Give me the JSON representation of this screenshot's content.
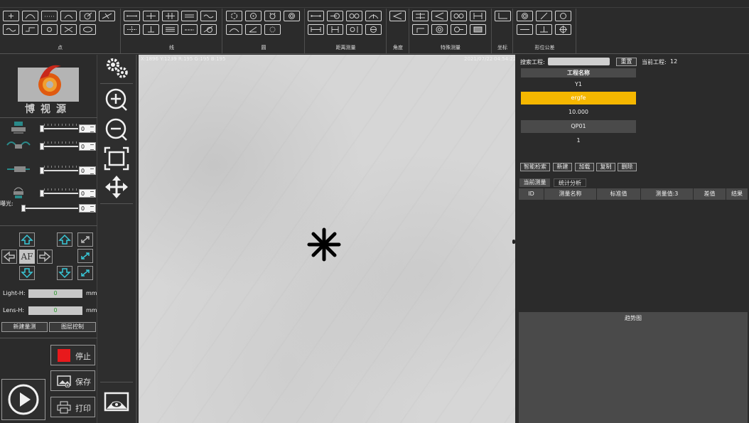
{
  "toolbar": {
    "groups": [
      {
        "label": "点"
      },
      {
        "label": "线"
      },
      {
        "label": "圆"
      },
      {
        "label": "距离测量"
      },
      {
        "label": "角度"
      },
      {
        "label": "特殊测量"
      },
      {
        "label": "坐标"
      },
      {
        "label": "形位公差"
      }
    ]
  },
  "logo": {
    "text": "博视源"
  },
  "lights": {
    "values": [
      "0",
      "0",
      "0",
      "0"
    ],
    "exposure_label": "曝光:",
    "exposure_value": "0"
  },
  "motion": {
    "af_label": "AF"
  },
  "heights": {
    "light_label": "Light-H:",
    "light_value": "0",
    "lens_label": "Lens-H:",
    "lens_value": "0",
    "unit": "mm"
  },
  "left_buttons": {
    "new_measure": "新建量测",
    "layer_control": "图层控制",
    "stop": "停止",
    "save": "保存",
    "print": "打印"
  },
  "image_view": {
    "coords": "X:1896  Y:1239  R:195  G:195  B:195",
    "date": "2021/07/22",
    "time": "04:54:22"
  },
  "right_panel": {
    "search_label": "搜索工程:",
    "reset_button": "重置",
    "current_project_label": "当前工程:",
    "current_project_value": "12",
    "list_header": "工程名称",
    "projects": [
      "Y1",
      "ergfe",
      "10.000",
      "QP01",
      "1"
    ],
    "actions": [
      "智能检索",
      "新建",
      "加载",
      "复制",
      "删除"
    ],
    "tabs": [
      "当前测量",
      "统计分析"
    ],
    "table_headers": [
      "ID",
      "测量名称",
      "标准值",
      "测量值:3",
      "差值",
      "结果"
    ],
    "trend_title": "趋势图"
  },
  "colors": {
    "selected_project": "#f5b700",
    "stop_red": "#e8191c",
    "arrow_cyan": "#38c8d8"
  }
}
